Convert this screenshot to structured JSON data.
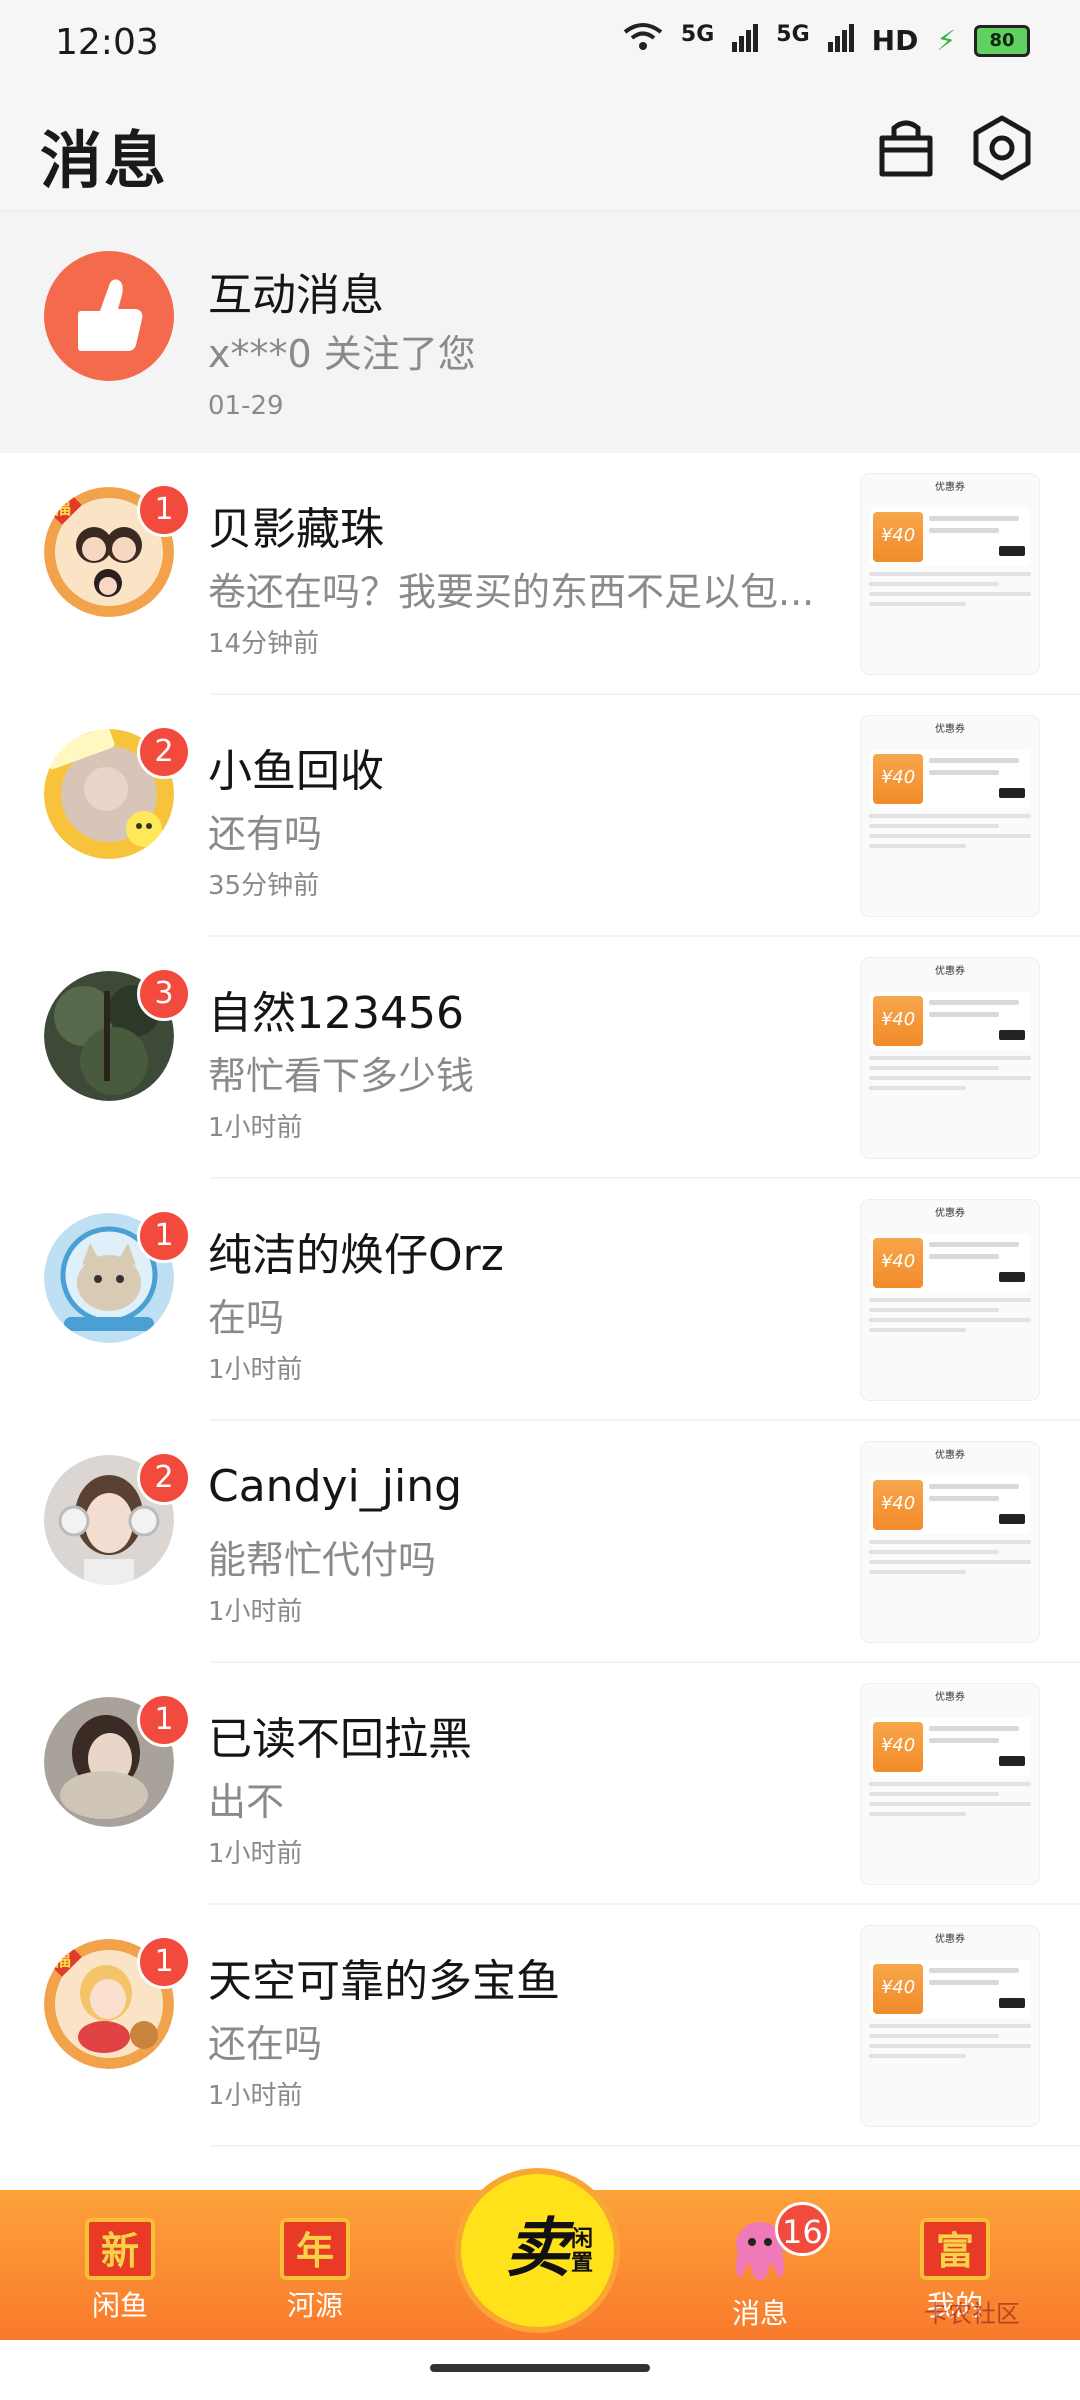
{
  "status_bar": {
    "time": "12:03",
    "network1": "5G",
    "network2": "5G",
    "hd": "HD",
    "battery": "80"
  },
  "header": {
    "title": "消息"
  },
  "interaction": {
    "title": "互动消息",
    "message": "x***0 关注了您",
    "date": "01-29"
  },
  "conversations": [
    {
      "name": "贝影藏珠",
      "message": "卷还在吗？我要买的东西不足以包...",
      "time": "14分钟前",
      "unread": "1",
      "avatar": "avatar-fortune-girls"
    },
    {
      "name": "小鱼回收",
      "message": "还有吗",
      "time": "35分钟前",
      "unread": "2",
      "avatar": "avatar-sticker-frame"
    },
    {
      "name": "自然123456",
      "message": "帮忙看下多少钱",
      "time": "1小时前",
      "unread": "3",
      "avatar": "avatar-forest"
    },
    {
      "name": "纯洁的焕仔Orz",
      "message": "在吗",
      "time": "1小时前",
      "unread": "1",
      "avatar": "avatar-cat-astronaut"
    },
    {
      "name": "Candyi_jing",
      "message": "能帮忙代付吗",
      "time": "1小时前",
      "unread": "2",
      "avatar": "avatar-girl-headphones"
    },
    {
      "name": "已读不回拉黑",
      "message": "出不",
      "time": "1小时前",
      "unread": "1",
      "avatar": "avatar-girl-scarf"
    },
    {
      "name": "天空可靠的多宝鱼",
      "message": "还在吗",
      "time": "1小时前",
      "unread": "1",
      "avatar": "avatar-fortune-doll"
    }
  ],
  "item_thumb": {
    "header": "优惠券",
    "coupon": "¥40"
  },
  "bottom_nav": {
    "items": [
      {
        "label": "闲鱼",
        "icon": "新"
      },
      {
        "label": "河源",
        "icon": "年"
      },
      {
        "label": "消息",
        "badge": "16"
      },
      {
        "label": "我的",
        "icon": "富"
      }
    ],
    "sell": {
      "big": "卖",
      "small": "闲置"
    }
  },
  "watermark": "卡农社区"
}
